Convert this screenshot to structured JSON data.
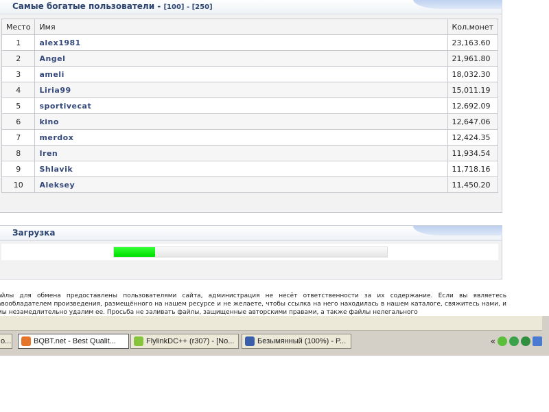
{
  "top_users": {
    "title": "Самые богатые пользователи -",
    "link_100": "[100]",
    "separator": " - ",
    "link_250": "[250]",
    "columns": [
      "Место",
      "Имя",
      "Кол.монет"
    ],
    "rows": [
      {
        "place": "1",
        "name": "alex1981",
        "coins": "23,163.60"
      },
      {
        "place": "2",
        "name": "Angel",
        "coins": "21,961.80"
      },
      {
        "place": "3",
        "name": "ameli",
        "coins": "18,032.30"
      },
      {
        "place": "4",
        "name": "Liria99",
        "coins": "15,011.19"
      },
      {
        "place": "5",
        "name": "sportivecat",
        "coins": "12,692.09"
      },
      {
        "place": "6",
        "name": "kino",
        "coins": "12,647.06"
      },
      {
        "place": "7",
        "name": "merdox",
        "coins": "12,424.35"
      },
      {
        "place": "8",
        "name": "Iren",
        "coins": "11,934.54"
      },
      {
        "place": "9",
        "name": "Shlavik",
        "coins": "11,718.16"
      },
      {
        "place": "10",
        "name": "Aleksey",
        "coins": "11,450.20"
      }
    ]
  },
  "loading": {
    "title": "Загрузка",
    "progress_fraction": 0.15
  },
  "disclaimer": "айлы для обмена предоставлены пользователями сайта, администрация не несёт ответственности за их содержание. Если вы являетесь авообладателем произведения, размещённого на нашем ресурсе и не желаете, чтобы ссылка на него находилась в нашем каталоге, свяжитесь нами, и мы незамедлительно удалим ее. Просьба не заливать файлы, защищенные авторскими правами, а также файлы нелегального",
  "taskbar": {
    "buttons": [
      {
        "label": "o...",
        "icon_color": "#3b6cc9"
      },
      {
        "label": "BQBT.net - Best Qualit...",
        "icon_color": "#e5752a",
        "active": true
      },
      {
        "label": "FlylinkDC++ (r307) - [No...",
        "icon_color": "#86c43c"
      },
      {
        "label": "Безымянный (100%) - P...",
        "icon_color": "#3a5fa8"
      }
    ],
    "tray_arrow": "«",
    "tray_icons": [
      "network-icon",
      "antivirus-icon",
      "user-icon",
      "monitor-icon"
    ]
  },
  "colors": {
    "header_text": "#2c4470",
    "progress_fill": "#00dd00"
  }
}
